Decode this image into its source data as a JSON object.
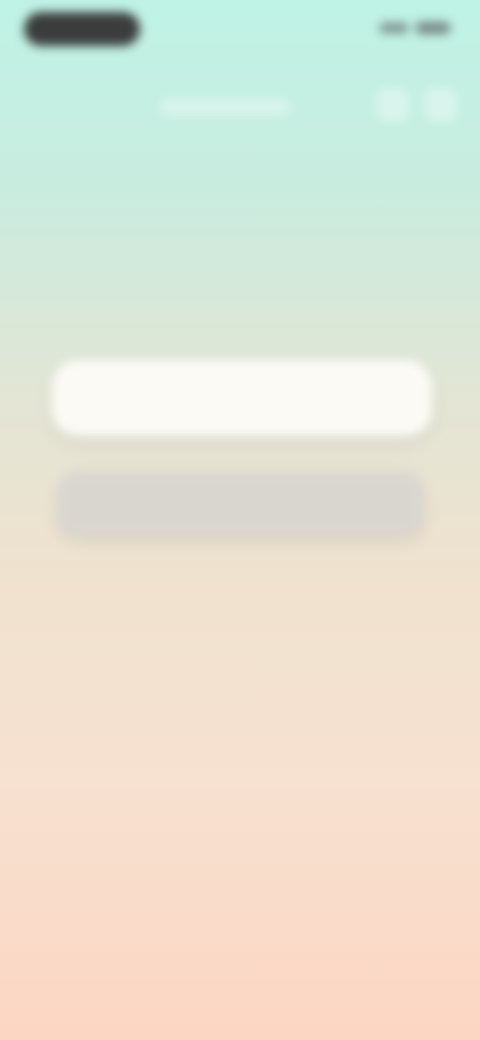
{
  "status_bar": {
    "left_pill": "",
    "right_icons": [
      "signal-icon",
      "battery-icon"
    ]
  },
  "top_nav": {
    "center_placeholder": "",
    "right_icons": [
      "icon",
      "icon"
    ]
  },
  "content": {
    "title": "",
    "subtitle": "",
    "input_placeholder": "",
    "primary_button_label": ""
  },
  "footer": {
    "text": ""
  }
}
